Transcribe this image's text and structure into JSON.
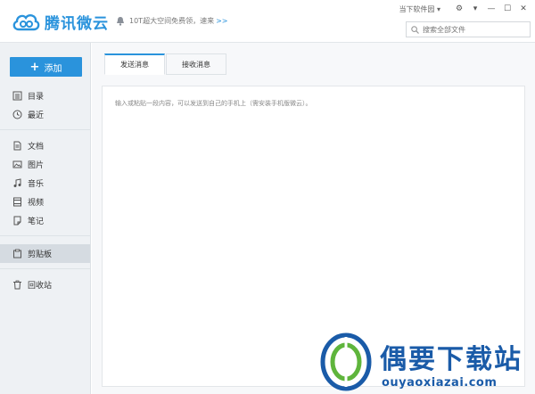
{
  "app": {
    "title": "腾讯微云"
  },
  "notice": {
    "text": "10T超大空间免费领，速来",
    "link": ">>"
  },
  "topbar": {
    "menu_label": "当下软件园"
  },
  "search": {
    "placeholder": "搜索全部文件"
  },
  "sidebar": {
    "add_label": "添加",
    "items": [
      {
        "label": "目录",
        "icon": "directory-icon"
      },
      {
        "label": "最近",
        "icon": "clock-icon"
      },
      {
        "label": "文档",
        "icon": "document-icon"
      },
      {
        "label": "图片",
        "icon": "image-icon"
      },
      {
        "label": "音乐",
        "icon": "music-icon"
      },
      {
        "label": "视频",
        "icon": "video-icon"
      },
      {
        "label": "笔记",
        "icon": "note-icon"
      },
      {
        "label": "剪贴板",
        "icon": "clipboard-icon"
      },
      {
        "label": "回收站",
        "icon": "trash-icon"
      }
    ]
  },
  "tabs": [
    {
      "label": "发送消息",
      "active": true
    },
    {
      "label": "接收消息",
      "active": false
    }
  ],
  "content": {
    "placeholder": "输入或粘贴一段内容，可以发送到自己的手机上（需安装手机版微云）。"
  },
  "watermark": {
    "title": "偶要下载站",
    "url": "ouyaoxiazai.com"
  },
  "colors": {
    "accent": "#2a93dc",
    "sidebar_bg": "#eef1f4",
    "watermark": "#1a5ba8"
  }
}
